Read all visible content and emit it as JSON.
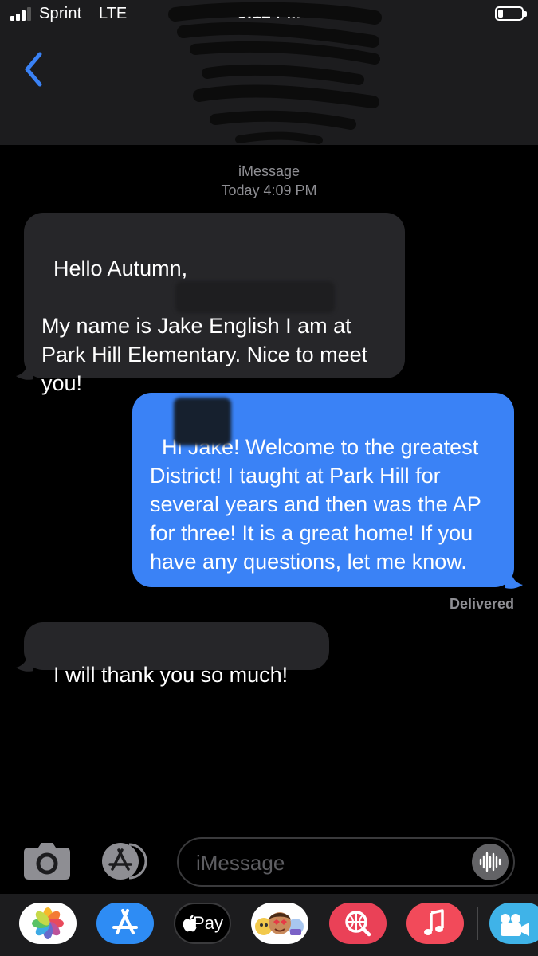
{
  "status_bar": {
    "carrier": "Sprint",
    "network": "LTE",
    "time": "9:12 PM",
    "battery_level": 0.2
  },
  "thread": {
    "service": "iMessage",
    "timestamp": "Today 4:09 PM",
    "messages": [
      {
        "direction": "incoming",
        "text": "Hello Autumn,\n\nMy name is Jake English I am at Park Hill Elementary. Nice to meet you!"
      },
      {
        "direction": "outgoing",
        "text": "Hi Jake! Welcome to the greatest District! I taught at Park Hill for several years and then was the AP for three! It is a great home! If you have any questions, let me know."
      },
      {
        "direction": "incoming",
        "text": "I will thank you so much!"
      }
    ],
    "delivery_status": "Delivered"
  },
  "composer": {
    "placeholder": "iMessage"
  },
  "app_drawer": {
    "apple_pay_label": "Pay",
    "apps": [
      "photos-icon",
      "app-store-icon",
      "apple-pay-icon",
      "memoji-icon",
      "web-search-icon",
      "music-icon",
      "clips-icon"
    ]
  },
  "colors": {
    "outgoing_bubble": "#3a82f6",
    "incoming_bubble": "#262629",
    "header_background": "#1c1c1e",
    "meta_text": "#8e8e93"
  }
}
